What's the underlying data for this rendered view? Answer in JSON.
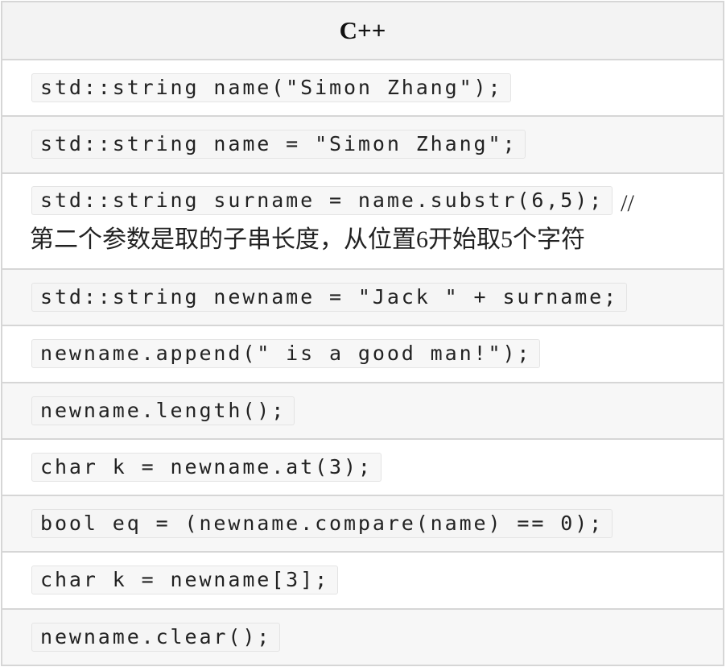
{
  "table": {
    "header": "C++",
    "rows": [
      {
        "code": "std::string name(\"Simon Zhang\");"
      },
      {
        "code": "std::string name = \"Simon Zhang\";"
      },
      {
        "code": "std::string surname = name.substr(6,5);",
        "comment_marker": "//",
        "comment_text": "第二个参数是取的子串长度，从位置6开始取5个字符"
      },
      {
        "code": "std::string newname = \"Jack \" + surname;"
      },
      {
        "code": "newname.append(\" is a good man!\");"
      },
      {
        "code": "newname.length();"
      },
      {
        "code": "char k = newname.at(3);"
      },
      {
        "code": "bool eq = (newname.compare(name) == 0);"
      },
      {
        "code": "char k = newname[3];"
      },
      {
        "code": "newname.clear();"
      }
    ]
  }
}
